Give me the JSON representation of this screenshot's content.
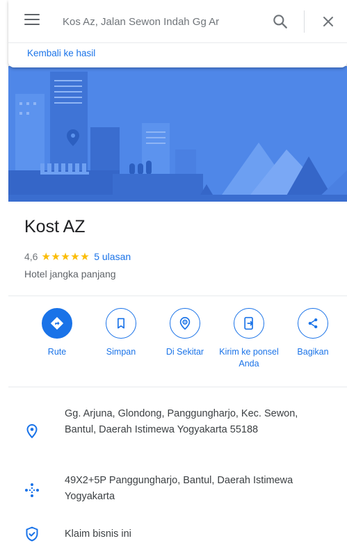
{
  "search": {
    "query": "Kos Az, Jalan Sewon Indah Gg Ar",
    "back_label": "Kembali ke hasil"
  },
  "place": {
    "name": "Kost AZ",
    "rating": "4,6",
    "rating_value": 4.6,
    "stars": "★★★★★",
    "reviews": "5 ulasan",
    "category": "Hotel jangka panjang"
  },
  "actions": [
    {
      "label": "Rute",
      "icon": "directions-icon"
    },
    {
      "label": "Simpan",
      "icon": "bookmark-icon"
    },
    {
      "label": "Di Sekitar",
      "icon": "nearby-icon"
    },
    {
      "label": "Kirim ke ponsel Anda",
      "icon": "send-to-phone-icon"
    },
    {
      "label": "Bagikan",
      "icon": "share-icon"
    }
  ],
  "details": {
    "address": "Gg. Arjuna, Glondong, Panggungharjo, Kec. Sewon, Bantul, Daerah Istimewa Yogyakarta 55188",
    "plus_code": "49X2+5P Panggungharjo, Bantul, Daerah Istimewa Yogyakarta",
    "claim": "Klaim bisnis ini"
  },
  "colors": {
    "accent": "#1a73e8",
    "hero": "#4f87e8",
    "star": "#fbbc04"
  }
}
